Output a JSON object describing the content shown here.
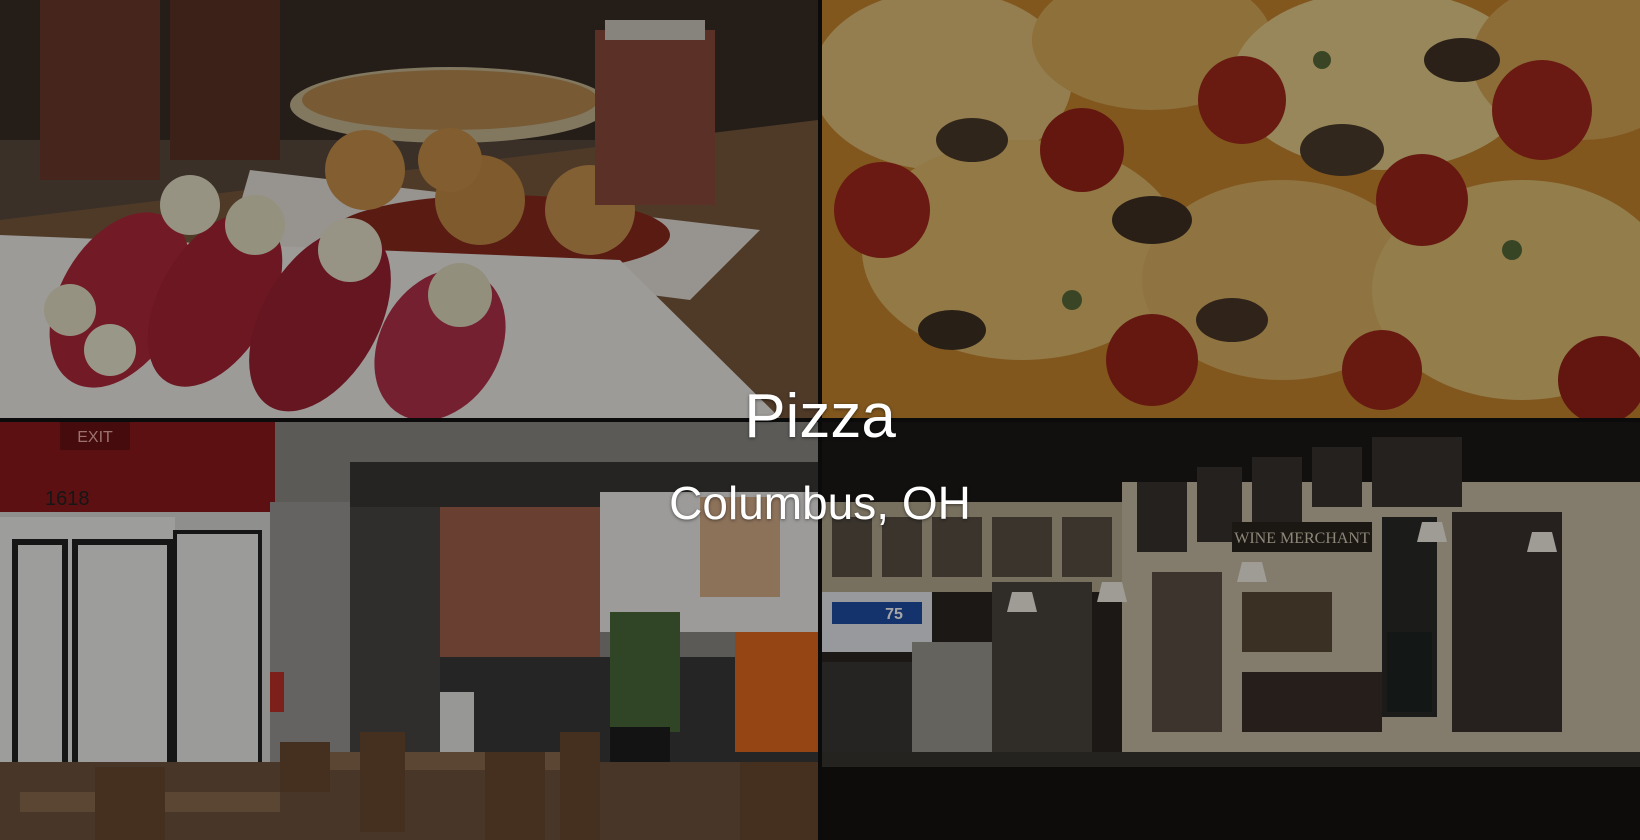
{
  "hero": {
    "title": "Pizza",
    "subtitle": "Columbus, OH"
  },
  "photos": [
    {
      "subject": "appetizers-on-bar-counter"
    },
    {
      "subject": "pizza-closeup"
    },
    {
      "subject": "restaurant-dining-room"
    },
    {
      "subject": "restaurant-bar"
    }
  ],
  "signage": {
    "exit_sign": "EXIT",
    "address_number": "1618",
    "tv_score": "75",
    "bar_sign": "WINE MERCHANT"
  },
  "colors": {
    "caption_text": "#ffffff",
    "overlay": "rgba(0,0,0,0.35)"
  }
}
